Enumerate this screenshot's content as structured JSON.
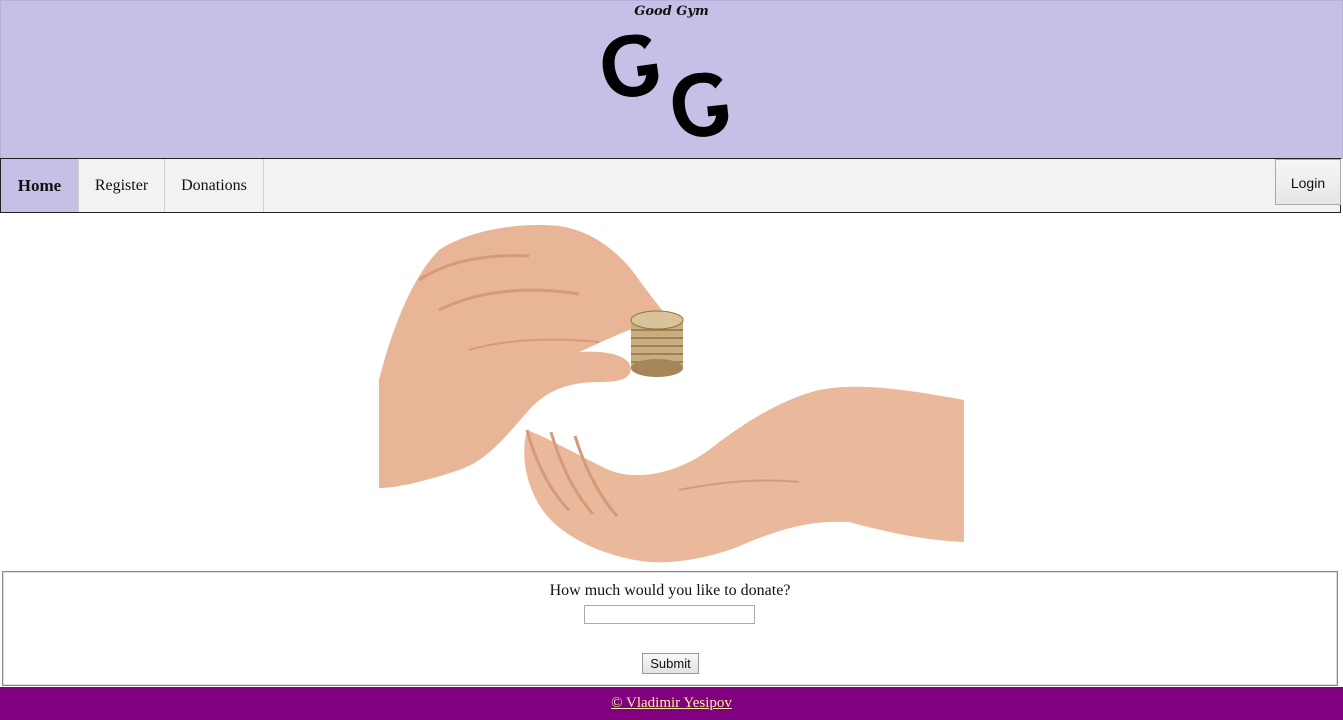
{
  "header": {
    "site_name": "Good Gym",
    "logo_letters": "GG",
    "background_color": "#c6bfe6"
  },
  "nav": {
    "items": [
      {
        "label": "Home",
        "active": true
      },
      {
        "label": "Register",
        "active": false
      },
      {
        "label": "Donations",
        "active": false
      }
    ],
    "login_label": "Login"
  },
  "hero": {
    "icon": "hands-giving-coins-image"
  },
  "donate": {
    "question": "How much would you like to donate?",
    "amount_value": "",
    "submit_label": "Submit"
  },
  "footer": {
    "copyright": "© Vladimir Yesipov",
    "background_color": "#800080",
    "link_color": "#ffef9a"
  }
}
